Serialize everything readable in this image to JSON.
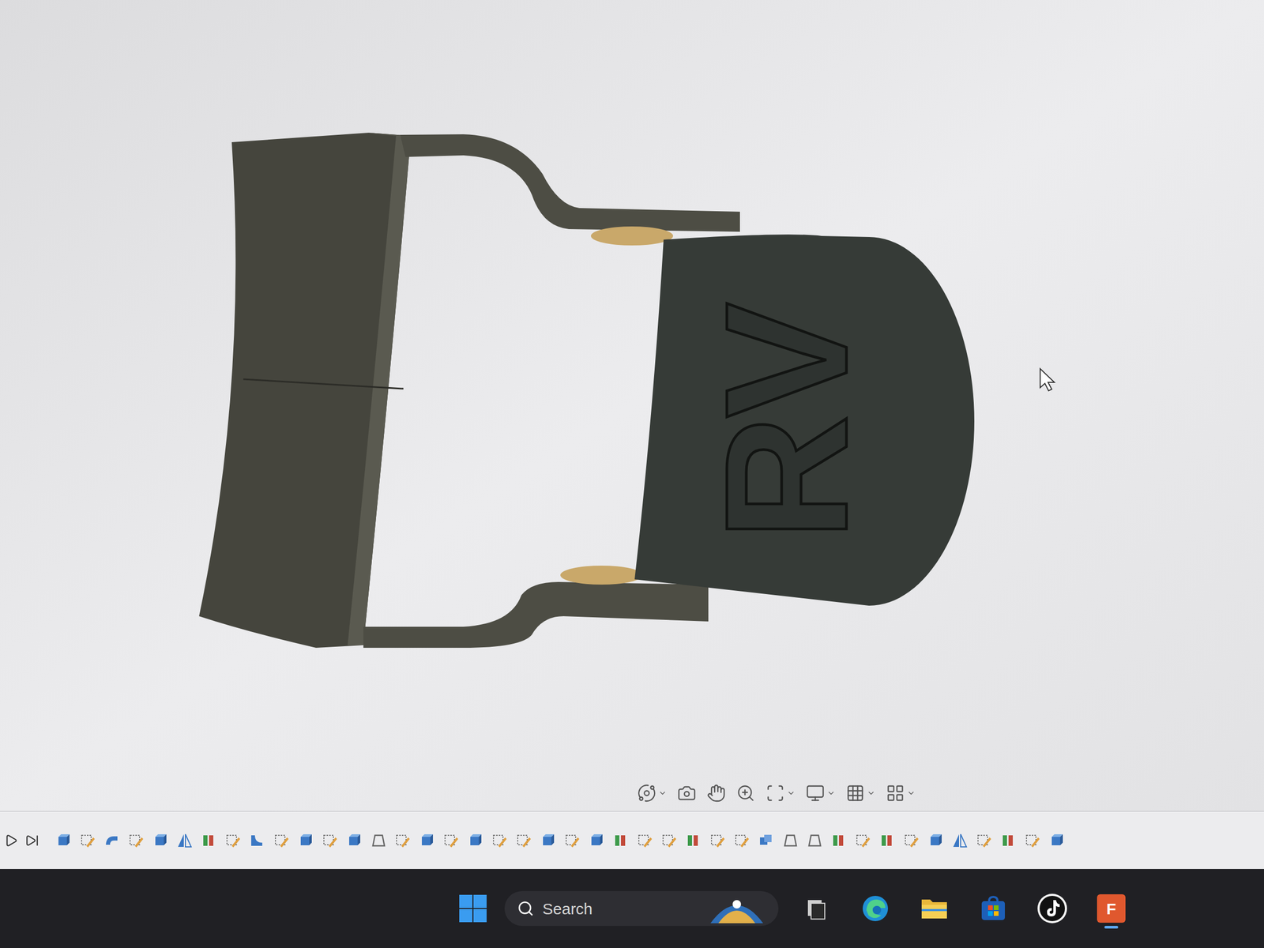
{
  "viewport": {
    "model_text": "RV"
  },
  "taskbar": {
    "search": {
      "placeholder": "Search"
    },
    "apps": [
      {
        "kind": "taskview",
        "active": false
      },
      {
        "kind": "edge",
        "active": false
      },
      {
        "kind": "explorer",
        "active": false
      },
      {
        "kind": "store",
        "active": false
      },
      {
        "kind": "tiktok",
        "active": false
      },
      {
        "kind": "fusion",
        "active": true,
        "label": "F"
      }
    ]
  }
}
